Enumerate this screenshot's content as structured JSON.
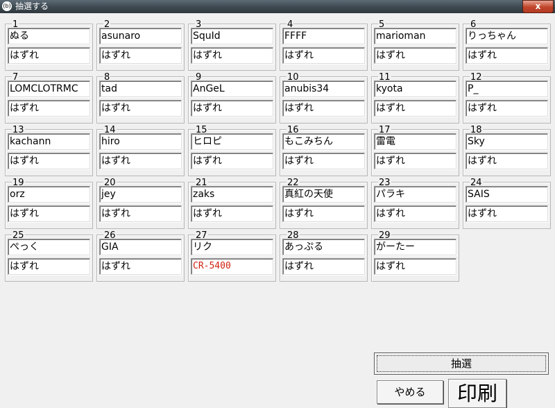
{
  "window": {
    "title": "抽選する",
    "icon": "app-logo-icon",
    "close_label": "x"
  },
  "colors": {
    "winner_text": "#d02010"
  },
  "entries": [
    {
      "num": "1",
      "name": "ぬる",
      "result": "はずれ"
    },
    {
      "num": "2",
      "name": "asunaro",
      "result": "はずれ"
    },
    {
      "num": "3",
      "name": "SquId",
      "result": "はずれ"
    },
    {
      "num": "4",
      "name": "FFFF",
      "result": "はずれ"
    },
    {
      "num": "5",
      "name": "marioman",
      "result": "はずれ"
    },
    {
      "num": "6",
      "name": "りっちゃん",
      "result": "はずれ"
    },
    {
      "num": "7",
      "name": "LOMCLOTRMC",
      "result": "はずれ"
    },
    {
      "num": "8",
      "name": "tad",
      "result": "はずれ"
    },
    {
      "num": "9",
      "name": "AnGeL",
      "result": "はずれ"
    },
    {
      "num": "10",
      "name": "anubis34",
      "result": "はずれ"
    },
    {
      "num": "11",
      "name": "kyota",
      "result": "はずれ"
    },
    {
      "num": "12",
      "name": "P_",
      "result": "はずれ"
    },
    {
      "num": "13",
      "name": "kachann",
      "result": "はずれ"
    },
    {
      "num": "14",
      "name": "hiro",
      "result": "はずれ"
    },
    {
      "num": "15",
      "name": "ヒロピ",
      "result": "はずれ"
    },
    {
      "num": "16",
      "name": "もこみちん",
      "result": "はずれ"
    },
    {
      "num": "17",
      "name": "雷電",
      "result": "はずれ"
    },
    {
      "num": "18",
      "name": "Sky",
      "result": "はずれ"
    },
    {
      "num": "19",
      "name": "orz",
      "result": "はずれ"
    },
    {
      "num": "20",
      "name": "jey",
      "result": "はずれ"
    },
    {
      "num": "21",
      "name": "zaks",
      "result": "はずれ"
    },
    {
      "num": "22",
      "name": "真紅の天使",
      "result": "はずれ"
    },
    {
      "num": "23",
      "name": "パラキ",
      "result": "はずれ"
    },
    {
      "num": "24",
      "name": "SAIS",
      "result": "はずれ"
    },
    {
      "num": "25",
      "name": "ぺっく",
      "result": "はずれ"
    },
    {
      "num": "26",
      "name": "GIA",
      "result": "はずれ"
    },
    {
      "num": "27",
      "name": "リク",
      "result": "CR-5400",
      "winner": true
    },
    {
      "num": "28",
      "name": "あっぷる",
      "result": "はずれ"
    },
    {
      "num": "29",
      "name": "がーたー",
      "result": "はずれ"
    }
  ],
  "buttons": {
    "draw": "抽選",
    "cancel": "やめる",
    "print": "印刷"
  }
}
